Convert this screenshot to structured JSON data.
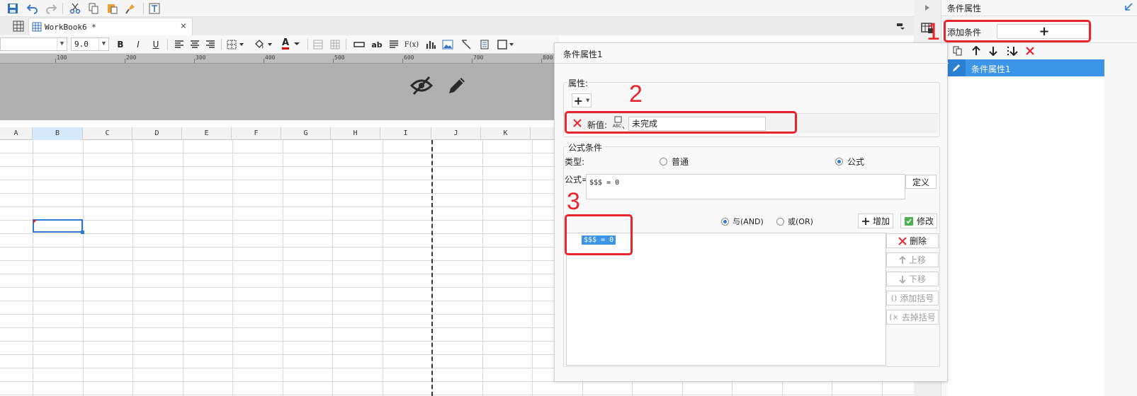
{
  "workbook_tab": {
    "title": "WorkBook6 *",
    "close": "×"
  },
  "format_bar": {
    "font_size": "9.0",
    "bold": "B",
    "italic": "I",
    "underline": "U",
    "text_color_glyph": "A",
    "ab_label": "ab",
    "fx_label": "F(x)"
  },
  "ruler": {
    "marks": [
      "100",
      "200",
      "300",
      "400",
      "500",
      "600",
      "700",
      "800"
    ]
  },
  "grid": {
    "columns": [
      "A",
      "B",
      "C",
      "D",
      "E",
      "F",
      "G",
      "H",
      "I",
      "J",
      "K"
    ],
    "selected_column": "B"
  },
  "right_panel": {
    "title": "条件属性",
    "add_condition_label": "添加条件",
    "add_button": "+",
    "list_items": [
      {
        "label": "条件属性1",
        "selected": true
      }
    ]
  },
  "dialog": {
    "title": "条件属性1",
    "attributes_label": "属性:",
    "add_attr_button": "+",
    "new_value_label": "新值:",
    "new_value": "未完成",
    "formula_condition_label": "公式条件",
    "type_label": "类型:",
    "type_options": [
      {
        "label": "普通",
        "selected": false
      },
      {
        "label": "公式",
        "selected": true
      }
    ],
    "formula_label": "公式=",
    "formula_value": "$$$ = 0",
    "define_button": "定义",
    "logic_options": [
      {
        "label": "与(AND)",
        "selected": true
      },
      {
        "label": "或(OR)",
        "selected": false
      }
    ],
    "add_button": "增加",
    "modify_button": "修改",
    "condition_items": [
      "$$$ = 0"
    ],
    "side_buttons": {
      "delete": "删除",
      "move_up": "上移",
      "move_down": "下移",
      "add_bracket": "添加括号",
      "remove_bracket": "去掉括号"
    }
  },
  "annotations": {
    "one": "1",
    "two": "2",
    "three": "3"
  },
  "colors": {
    "accent": "#2b7bd6",
    "annotation_red": "#e8242d",
    "selected_row": "#3d95e8"
  }
}
